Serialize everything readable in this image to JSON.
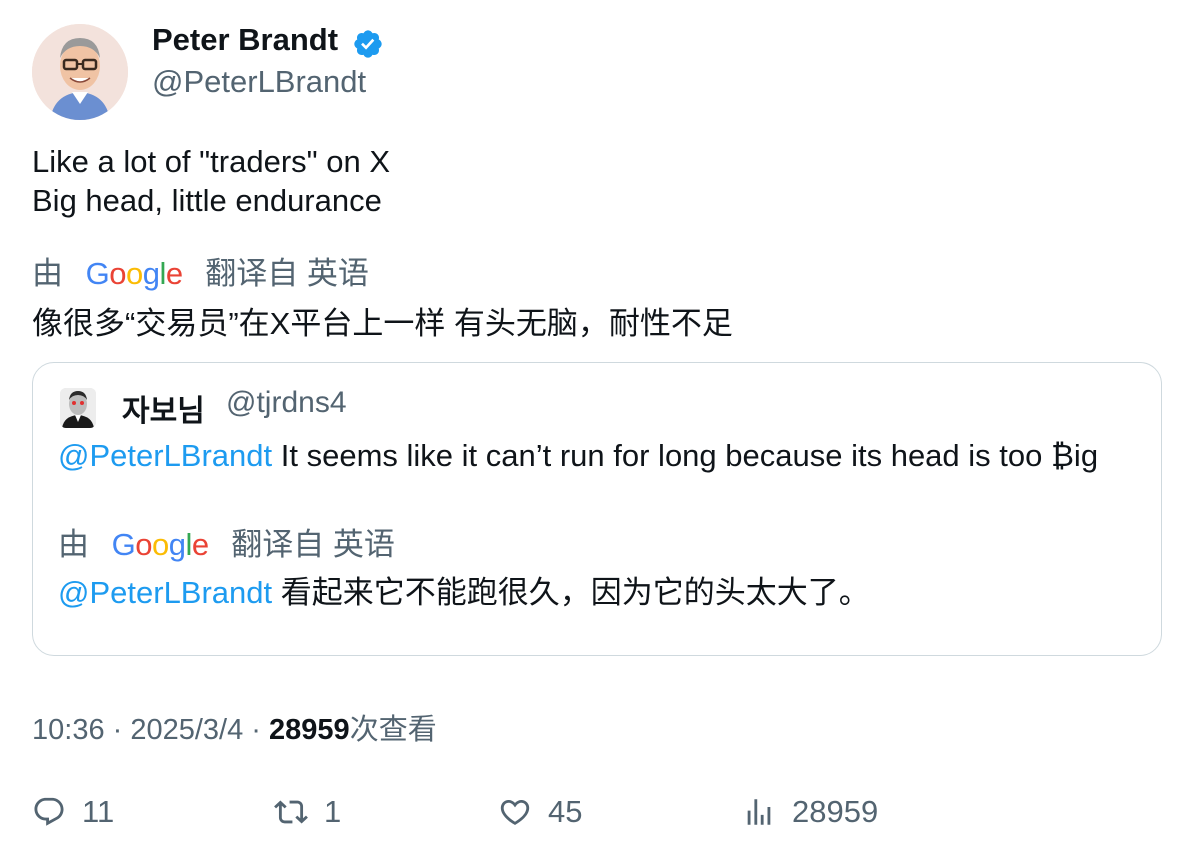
{
  "author": {
    "name": "Peter Brandt",
    "handle": "@PeterLBrandt",
    "verified": true,
    "verified_color": "#1d9bf0"
  },
  "tweet": {
    "line1": "Like a lot of \"traders\" on X",
    "line2": "Big head, little endurance",
    "translate_prefix": "由",
    "translate_brand": "Google",
    "translate_suffix": "翻译自 英语",
    "translation": "像很多“交易员”在X平台上一样 有头无脑，耐性不足"
  },
  "quote": {
    "name": "자보님",
    "handle": "@tjrdns4",
    "mention": "@PeterLBrandt",
    "text": " It seems like it can’t run for long because its head is too ₿ig",
    "translate_prefix": "由",
    "translate_brand": "Google",
    "translate_suffix": "翻译自 英语",
    "translated_mention": "@PeterLBrandt",
    "translated_text": " 看起来它不能跑很久，因为它的头太大了。"
  },
  "meta": {
    "time": "10:36",
    "sep1": " · ",
    "date": "2025/3/4",
    "sep2": " · ",
    "views": "28959",
    "views_suffix": "次查看"
  },
  "actions": {
    "replies": "11",
    "retweets": "1",
    "likes": "45",
    "views": "28959"
  },
  "colors": {
    "text": "#0f1419",
    "secondary": "#536471",
    "accent": "#1d9bf0",
    "border": "#cfd9de"
  }
}
